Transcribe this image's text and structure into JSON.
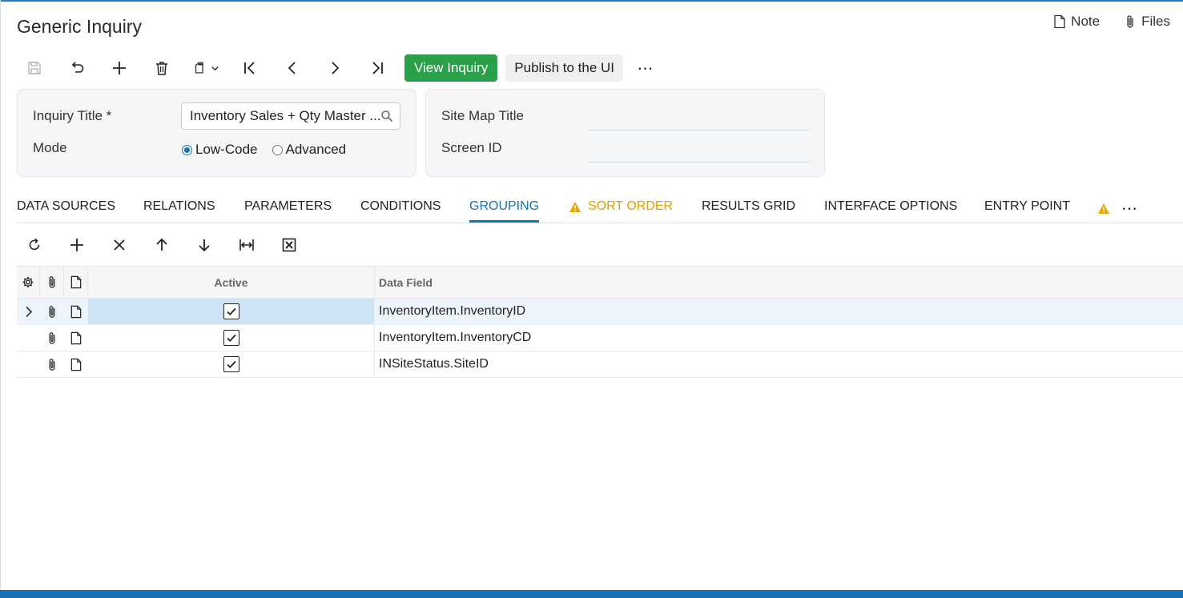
{
  "page": {
    "title": "Generic Inquiry"
  },
  "top_links": {
    "note": "Note",
    "files": "Files"
  },
  "toolbar": {
    "icons": [
      "save-icon",
      "undo-icon",
      "add-icon",
      "delete-icon",
      "copy-paste-icon",
      "first-record-icon",
      "previous-record-icon",
      "next-record-icon",
      "last-record-icon"
    ],
    "view_inquiry": "View Inquiry",
    "publish": "Publish to the UI",
    "more": "⋯"
  },
  "summary": {
    "inquiry_title_label": "Inquiry Title *",
    "inquiry_title_value": "Inventory Sales + Qty Master ...",
    "mode_label": "Mode",
    "mode_options": [
      "Low-Code",
      "Advanced"
    ],
    "mode_selected": "Low-Code",
    "site_map_title_label": "Site Map Title",
    "site_map_title_value": "",
    "screen_id_label": "Screen ID",
    "screen_id_value": ""
  },
  "tabs": [
    {
      "label": "DATA SOURCES"
    },
    {
      "label": "RELATIONS"
    },
    {
      "label": "PARAMETERS"
    },
    {
      "label": "CONDITIONS"
    },
    {
      "label": "GROUPING",
      "active": true
    },
    {
      "label": "SORT ORDER",
      "warning": true
    },
    {
      "label": "RESULTS GRID"
    },
    {
      "label": "INTERFACE OPTIONS"
    },
    {
      "label": "ENTRY POINT"
    }
  ],
  "tabs_more": "⋯",
  "grid_toolbar": {
    "icons": [
      "refresh-icon",
      "add-row-icon",
      "delete-row-icon",
      "move-up-icon",
      "move-down-icon",
      "fit-columns-icon",
      "export-excel-icon"
    ]
  },
  "grid": {
    "columns": {
      "active": "Active",
      "data_field": "Data Field"
    },
    "rows": [
      {
        "active": true,
        "data_field": "InventoryItem.InventoryID",
        "selected": true
      },
      {
        "active": true,
        "data_field": "InventoryItem.InventoryCD"
      },
      {
        "active": true,
        "data_field": "INSiteStatus.SiteID"
      }
    ]
  },
  "colors": {
    "accent": "#1673b8",
    "primary_button": "#2aa04a",
    "warning": "#e0a000"
  }
}
